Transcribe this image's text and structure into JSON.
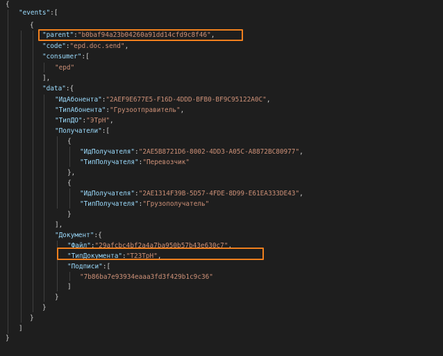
{
  "colors": {
    "background": "#1e1e1e",
    "key": "#9cdcfe",
    "string": "#ce9178",
    "punctuation": "#d4d4d4",
    "indent_guide": "#404040",
    "highlight_box": "#f0801e"
  },
  "lines": [
    {
      "tokens": [
        {
          "t": "{",
          "c": "pun"
        }
      ]
    },
    {
      "tokens": [
        {
          "t": "\"events\"",
          "c": "key"
        },
        {
          "t": ":[",
          "c": "pun"
        }
      ]
    },
    {
      "tokens": [
        {
          "t": "{",
          "c": "pun"
        }
      ]
    },
    {
      "tokens": [
        {
          "t": "\"parent\"",
          "c": "key"
        },
        {
          "t": ":",
          "c": "pun"
        },
        {
          "t": "\"b0baf94a23b04260a91dd14cfd9c8f46\"",
          "c": "str"
        },
        {
          "t": ",",
          "c": "pun"
        }
      ]
    },
    {
      "tokens": [
        {
          "t": "\"code\"",
          "c": "key"
        },
        {
          "t": ":",
          "c": "pun"
        },
        {
          "t": "\"epd.doc.send\"",
          "c": "str"
        },
        {
          "t": ",",
          "c": "pun"
        }
      ]
    },
    {
      "tokens": [
        {
          "t": "\"consumer\"",
          "c": "key"
        },
        {
          "t": ":[",
          "c": "pun"
        }
      ]
    },
    {
      "tokens": [
        {
          "t": "\"epd\"",
          "c": "str"
        }
      ]
    },
    {
      "tokens": [
        {
          "t": "],",
          "c": "pun"
        }
      ]
    },
    {
      "tokens": [
        {
          "t": "\"data\"",
          "c": "key"
        },
        {
          "t": ":{",
          "c": "pun"
        }
      ]
    },
    {
      "tokens": [
        {
          "t": "\"ИдАбонента\"",
          "c": "key"
        },
        {
          "t": ":",
          "c": "pun"
        },
        {
          "t": "\"2AEF9E677E5-F16D-4DDD-BFB0-BF9C95122A0C\"",
          "c": "str"
        },
        {
          "t": ",",
          "c": "pun"
        }
      ]
    },
    {
      "tokens": [
        {
          "t": "\"ТипАбонента\"",
          "c": "key"
        },
        {
          "t": ":",
          "c": "pun"
        },
        {
          "t": "\"Грузоотправитель\"",
          "c": "str"
        },
        {
          "t": ",",
          "c": "pun"
        }
      ]
    },
    {
      "tokens": [
        {
          "t": "\"ТипДО\"",
          "c": "key"
        },
        {
          "t": ":",
          "c": "pun"
        },
        {
          "t": "\"ЭТрН\"",
          "c": "str"
        },
        {
          "t": ",",
          "c": "pun"
        }
      ]
    },
    {
      "tokens": [
        {
          "t": "\"Получатели\"",
          "c": "key"
        },
        {
          "t": ":[",
          "c": "pun"
        }
      ]
    },
    {
      "tokens": [
        {
          "t": "{",
          "c": "pun"
        }
      ]
    },
    {
      "tokens": [
        {
          "t": "\"ИдПолучателя\"",
          "c": "key"
        },
        {
          "t": ":",
          "c": "pun"
        },
        {
          "t": "\"2AE5B8721D6-8002-4DD3-A05C-A8872BC80977\"",
          "c": "str"
        },
        {
          "t": ",",
          "c": "pun"
        }
      ]
    },
    {
      "tokens": [
        {
          "t": "\"ТипПолучателя\"",
          "c": "key"
        },
        {
          "t": ":",
          "c": "pun"
        },
        {
          "t": "\"Перевозчик\"",
          "c": "str"
        }
      ]
    },
    {
      "tokens": [
        {
          "t": "},",
          "c": "pun"
        }
      ]
    },
    {
      "tokens": [
        {
          "t": "{",
          "c": "pun"
        }
      ]
    },
    {
      "tokens": [
        {
          "t": "\"ИдПолучателя\"",
          "c": "key"
        },
        {
          "t": ":",
          "c": "pun"
        },
        {
          "t": "\"2AE1314F39B-5D57-4FDE-8D99-E61EA333DE43\"",
          "c": "str"
        },
        {
          "t": ",",
          "c": "pun"
        }
      ]
    },
    {
      "tokens": [
        {
          "t": "\"ТипПолучателя\"",
          "c": "key"
        },
        {
          "t": ":",
          "c": "pun"
        },
        {
          "t": "\"Грузополучатель\"",
          "c": "str"
        }
      ]
    },
    {
      "tokens": [
        {
          "t": "}",
          "c": "pun"
        }
      ]
    },
    {
      "tokens": [
        {
          "t": "],",
          "c": "pun"
        }
      ]
    },
    {
      "tokens": [
        {
          "t": "\"Документ\"",
          "c": "key"
        },
        {
          "t": ":{",
          "c": "pun"
        }
      ]
    },
    {
      "tokens": [
        {
          "t": "\"Файл\"",
          "c": "key"
        },
        {
          "t": ":",
          "c": "pun"
        },
        {
          "t": "\"29afcbc4bf2a4a7ba950b57b43e630c7\"",
          "c": "str"
        },
        {
          "t": ",",
          "c": "pun"
        }
      ]
    },
    {
      "tokens": [
        {
          "t": "\"ТипДокумента\"",
          "c": "key"
        },
        {
          "t": ":",
          "c": "pun"
        },
        {
          "t": "\"Т23ТрН\"",
          "c": "str"
        },
        {
          "t": ",",
          "c": "pun"
        }
      ]
    },
    {
      "tokens": [
        {
          "t": "\"Подписи\"",
          "c": "key"
        },
        {
          "t": ":[",
          "c": "pun"
        }
      ]
    },
    {
      "tokens": [
        {
          "t": "\"7b86ba7e93934eaaa3fd3f429b1c9c36\"",
          "c": "str"
        }
      ]
    },
    {
      "tokens": [
        {
          "t": "]",
          "c": "pun"
        }
      ]
    },
    {
      "tokens": [
        {
          "t": "}",
          "c": "pun"
        }
      ]
    },
    {
      "tokens": [
        {
          "t": "}",
          "c": "pun"
        }
      ]
    },
    {
      "tokens": [
        {
          "t": "}",
          "c": "pun"
        }
      ]
    },
    {
      "tokens": [
        {
          "t": "]",
          "c": "pun"
        }
      ]
    },
    {
      "tokens": [
        {
          "t": "}",
          "c": "pun"
        }
      ]
    }
  ]
}
